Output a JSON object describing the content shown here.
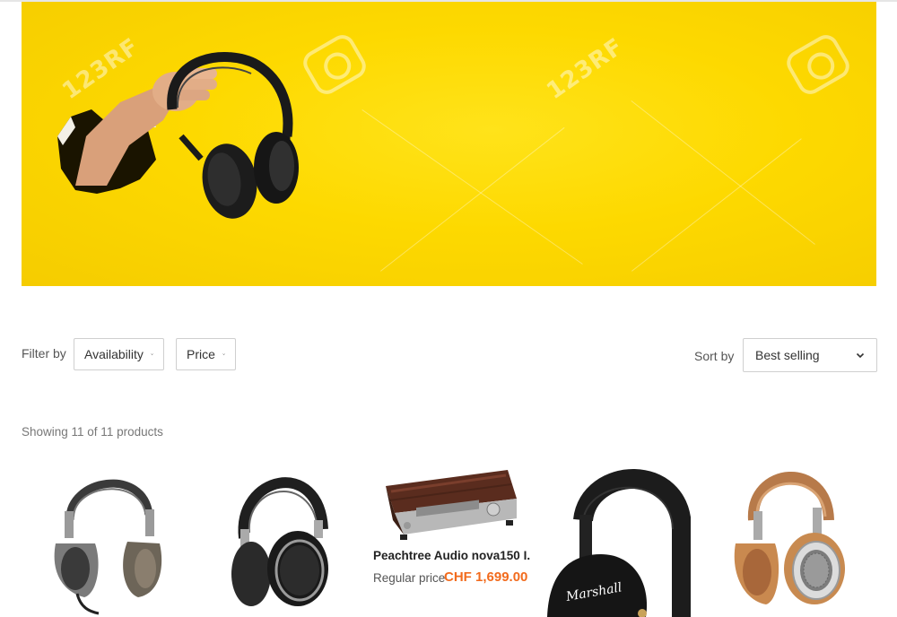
{
  "banner": {
    "watermark_text": "123RF"
  },
  "filters": {
    "label": "Filter by",
    "availability_label": "Availability",
    "price_label": "Price"
  },
  "sort": {
    "label": "Sort by",
    "selected": "Best selling"
  },
  "results": {
    "showing_text": "Showing 11 of 11 products"
  },
  "products": [
    {
      "name": "",
      "image": "silver-grey-over-ear-headphones"
    },
    {
      "name": "",
      "image": "black-wireless-headphones"
    },
    {
      "name": "Peachtree Audio nova150 I...",
      "price_label": "Regular price",
      "price": "CHF 1,699.00",
      "image": "wood-amplifier"
    },
    {
      "name": "",
      "image": "marshall-black-headphones",
      "logo_text": "Marshall"
    },
    {
      "name": "",
      "image": "tan-leather-headphones"
    }
  ],
  "colors": {
    "banner_yellow": "#fdd900",
    "price_orange": "#f26b1d"
  }
}
